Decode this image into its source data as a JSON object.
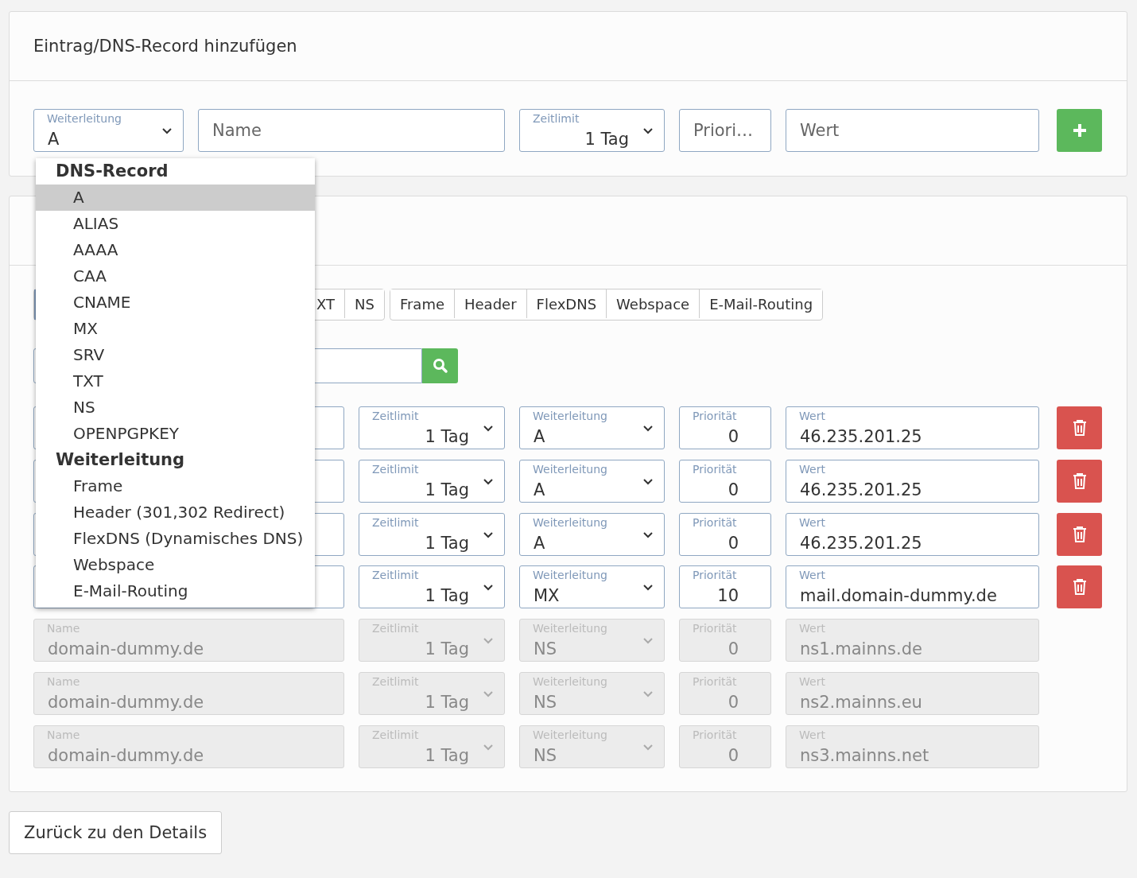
{
  "add_card": {
    "title": "Eintrag/DNS-Record hinzufügen",
    "type_select": {
      "label": "Weiterleitung",
      "value": "A"
    },
    "name_field": {
      "placeholder": "Name"
    },
    "ttl_select": {
      "label": "Zeitlimit",
      "value": "1 Tag"
    },
    "priority_field": {
      "placeholder": "Priori…"
    },
    "value_field": {
      "placeholder": "Wert"
    }
  },
  "type_dropdown": {
    "groups": [
      {
        "label": "DNS-Record",
        "options": [
          {
            "label": "A",
            "selected": true
          },
          {
            "label": "ALIAS",
            "selected": false
          },
          {
            "label": "AAAA",
            "selected": false
          },
          {
            "label": "CAA",
            "selected": false
          },
          {
            "label": "CNAME",
            "selected": false
          },
          {
            "label": "MX",
            "selected": false
          },
          {
            "label": "SRV",
            "selected": false
          },
          {
            "label": "TXT",
            "selected": false
          },
          {
            "label": "NS",
            "selected": false
          },
          {
            "label": "OPENPGPKEY",
            "selected": false
          }
        ]
      },
      {
        "label": "Weiterleitung",
        "options": [
          {
            "label": "Frame",
            "selected": false
          },
          {
            "label": "Header (301,302 Redirect)",
            "selected": false
          },
          {
            "label": "FlexDNS (Dynamisches DNS)",
            "selected": false
          },
          {
            "label": "Webspace",
            "selected": false
          },
          {
            "label": "E-Mail-Routing",
            "selected": false
          }
        ]
      }
    ]
  },
  "filter_tabs": [
    [
      "XT",
      "NS"
    ],
    [
      "Frame",
      "Header",
      "FlexDNS",
      "Webspace",
      "E-Mail-Routing"
    ]
  ],
  "records": [
    {
      "disabled": false,
      "ttl": {
        "label": "Zeitlimit",
        "value": "1 Tag"
      },
      "type": {
        "label": "Weiterleitung",
        "value": "A"
      },
      "priority": {
        "label": "Priorität",
        "value": "0"
      },
      "value": {
        "label": "Wert",
        "value": "46.235.201.25"
      }
    },
    {
      "disabled": false,
      "ttl": {
        "label": "Zeitlimit",
        "value": "1 Tag"
      },
      "type": {
        "label": "Weiterleitung",
        "value": "A"
      },
      "priority": {
        "label": "Priorität",
        "value": "0"
      },
      "value": {
        "label": "Wert",
        "value": "46.235.201.25"
      }
    },
    {
      "disabled": false,
      "ttl": {
        "label": "Zeitlimit",
        "value": "1 Tag"
      },
      "type": {
        "label": "Weiterleitung",
        "value": "A"
      },
      "priority": {
        "label": "Priorität",
        "value": "0"
      },
      "value": {
        "label": "Wert",
        "value": "46.235.201.25"
      }
    },
    {
      "disabled": false,
      "ttl": {
        "label": "Zeitlimit",
        "value": "1 Tag"
      },
      "type": {
        "label": "Weiterleitung",
        "value": "MX"
      },
      "priority": {
        "label": "Priorität",
        "value": "10"
      },
      "value": {
        "label": "Wert",
        "value": "mail.domain-dummy.de"
      }
    },
    {
      "disabled": true,
      "name": {
        "label": "Name",
        "value": "domain-dummy.de"
      },
      "ttl": {
        "label": "Zeitlimit",
        "value": "1 Tag"
      },
      "type": {
        "label": "Weiterleitung",
        "value": "NS"
      },
      "priority": {
        "label": "Priorität",
        "value": "0"
      },
      "value": {
        "label": "Wert",
        "value": "ns1.mainns.de"
      }
    },
    {
      "disabled": true,
      "name": {
        "label": "Name",
        "value": "domain-dummy.de"
      },
      "ttl": {
        "label": "Zeitlimit",
        "value": "1 Tag"
      },
      "type": {
        "label": "Weiterleitung",
        "value": "NS"
      },
      "priority": {
        "label": "Priorität",
        "value": "0"
      },
      "value": {
        "label": "Wert",
        "value": "ns2.mainns.eu"
      }
    },
    {
      "disabled": true,
      "name": {
        "label": "Name",
        "value": "domain-dummy.de"
      },
      "ttl": {
        "label": "Zeitlimit",
        "value": "1 Tag"
      },
      "type": {
        "label": "Weiterleitung",
        "value": "NS"
      },
      "priority": {
        "label": "Priorität",
        "value": "0"
      },
      "value": {
        "label": "Wert",
        "value": "ns3.mainns.net"
      }
    }
  ],
  "back_button": "Zurück zu den Details"
}
